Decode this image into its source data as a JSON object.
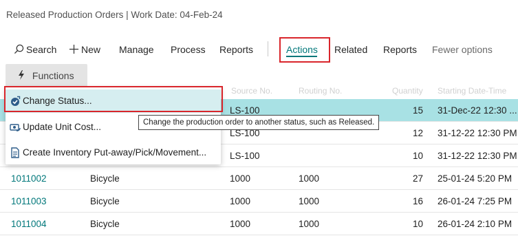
{
  "page": {
    "title": "Released Production Orders | Work Date: 04-Feb-24"
  },
  "actionbar": {
    "search": "Search",
    "new": "New",
    "manage": "Manage",
    "process": "Process",
    "reports": "Reports",
    "actions": "Actions",
    "related": "Related",
    "reports2": "Reports",
    "fewer": "Fewer options"
  },
  "functions": {
    "label": "Functions"
  },
  "grid": {
    "headers": [
      "Source No.",
      "Routing No.",
      "Quantity",
      "Starting Date-Time"
    ],
    "rows": [
      {
        "no": "",
        "desc": "",
        "src": "LS-100",
        "route": "",
        "qty": "15",
        "date": "31-Dec-22 12:30 ..."
      },
      {
        "no": "",
        "desc": "",
        "src": "LS-100",
        "route": "",
        "qty": "12",
        "date": "31-12-22 12:30 PM"
      },
      {
        "no": "",
        "desc": "",
        "src": "LS-100",
        "route": "",
        "qty": "10",
        "date": "31-12-22 12:30 PM"
      },
      {
        "no": "1011002",
        "desc": "Bicycle",
        "src": "1000",
        "route": "1000",
        "qty": "27",
        "date": "25-01-24 5:20 PM"
      },
      {
        "no": "1011003",
        "desc": "Bicycle",
        "src": "1000",
        "route": "1000",
        "qty": "16",
        "date": "26-01-24 7:25 PM"
      },
      {
        "no": "1011004",
        "desc": "Bicycle",
        "src": "1000",
        "route": "1000",
        "qty": "10",
        "date": "26-01-24 2:10 PM"
      }
    ]
  },
  "menu": {
    "items": [
      {
        "label": "Change Status...",
        "icon": "change-status-icon"
      },
      {
        "label": "Update Unit Cost...",
        "icon": "update-cost-icon"
      },
      {
        "label": "Create Inventory Put-away/Pick/Movement...",
        "icon": "document-icon"
      }
    ]
  },
  "tooltip": {
    "text": "Change the production order to another status, such as Released."
  },
  "colors": {
    "accent": "#00777a",
    "selected_row": "#a8e1e4",
    "highlight": "#d9252b"
  }
}
